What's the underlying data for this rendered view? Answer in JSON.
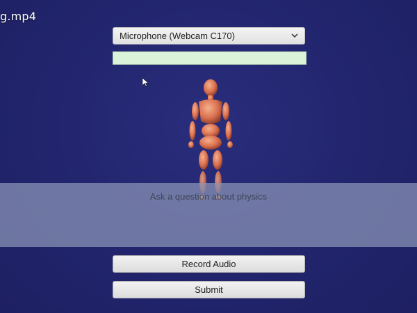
{
  "video": {
    "title": "g.mp4"
  },
  "microphone": {
    "selected": "Microphone (Webcam C170)"
  },
  "question": {
    "placeholder": "Ask a question about physics"
  },
  "buttons": {
    "record": "Record Audio",
    "submit": "Submit"
  },
  "colors": {
    "background": "#23266f",
    "level_bar": "#dbf3d8",
    "panel": "#8c96b9",
    "figure": "#e0896c"
  }
}
